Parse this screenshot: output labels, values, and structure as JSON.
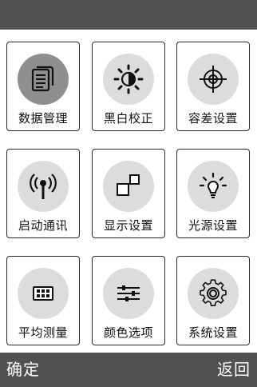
{
  "tiles": [
    {
      "label": "数据管理",
      "icon": "document-icon"
    },
    {
      "label": "黑白校正",
      "icon": "brightness-icon"
    },
    {
      "label": "容差设置",
      "icon": "crosshair-icon"
    },
    {
      "label": "启动通讯",
      "icon": "signal-antenna-icon"
    },
    {
      "label": "显示设置",
      "icon": "display-squares-icon"
    },
    {
      "label": "光源设置",
      "icon": "light-bulb-icon"
    },
    {
      "label": "平均测量",
      "icon": "keypad-grid-icon"
    },
    {
      "label": "颜色选项",
      "icon": "sliders-icon"
    },
    {
      "label": "系统设置",
      "icon": "gear-icon"
    }
  ],
  "footer": {
    "confirm_label": "确定",
    "back_label": "返回"
  },
  "colors": {
    "bar": "#515151",
    "circle": "#dcdcdc",
    "circle_active": "#8f8f8f"
  }
}
